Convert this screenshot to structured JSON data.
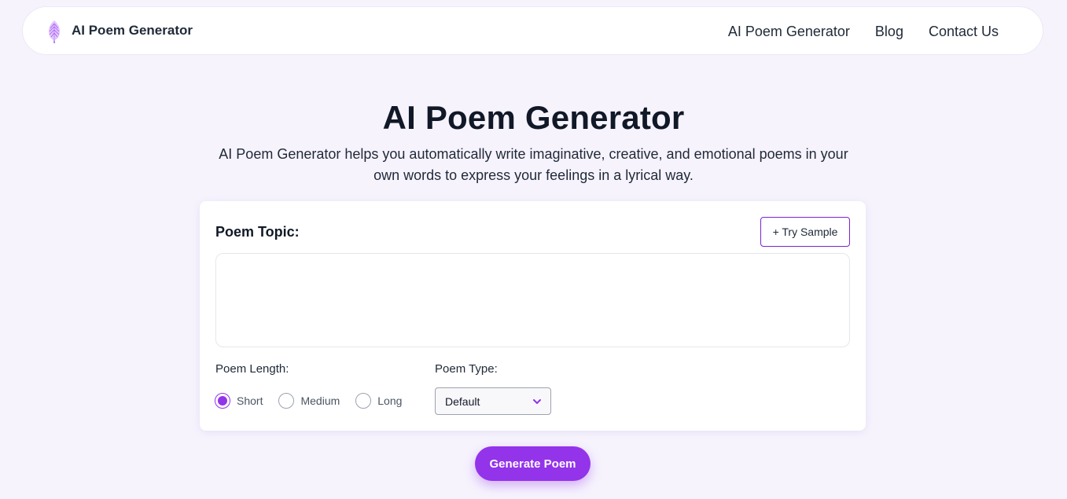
{
  "brand": {
    "name": "AI Poem Generator",
    "logo_icon": "feather-icon"
  },
  "nav": {
    "items": [
      {
        "label": "AI Poem Generator"
      },
      {
        "label": "Blog"
      },
      {
        "label": "Contact Us"
      }
    ]
  },
  "hero": {
    "title": "AI Poem Generator",
    "description": "AI Poem Generator helps you automatically write imaginative, creative, and emotional poems in your own words to express your feelings in a lyrical way."
  },
  "form": {
    "topic_label": "Poem Topic:",
    "try_sample_label": "+ Try Sample",
    "topic_value": "",
    "length_label": "Poem Length:",
    "length_options": [
      {
        "label": "Short",
        "checked": true
      },
      {
        "label": "Medium",
        "checked": false
      },
      {
        "label": "Long",
        "checked": false
      }
    ],
    "type_label": "Poem Type:",
    "type_selected": "Default",
    "generate_label": "Generate Poem"
  },
  "colors": {
    "accent": "#9333ea",
    "page_background": "#f6f3fd",
    "try_sample_border": "#7e22ce"
  }
}
